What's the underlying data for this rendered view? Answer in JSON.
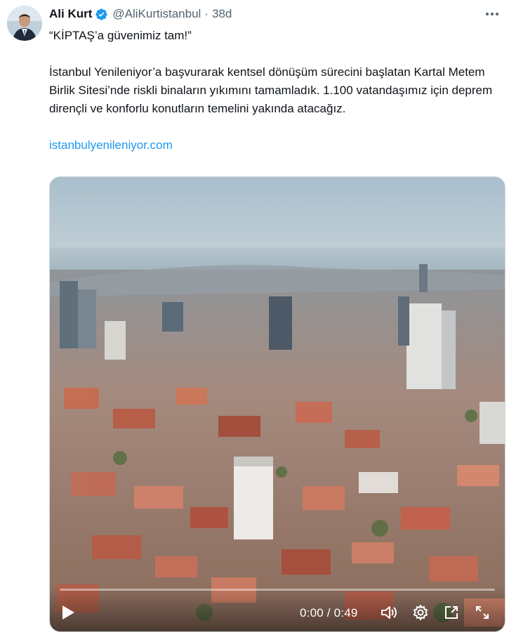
{
  "author": {
    "name": "Ali Kurt",
    "handle": "@AliKurtistanbul",
    "separator": "·",
    "time": "38d",
    "verified_color": "#1d9bf0"
  },
  "tweet": {
    "line1": "“KİPTAŞ’a güvenimiz tam!”",
    "paragraph": "İstanbul Yenileniyor’a başvurarak kentsel dönüşüm sürecini başlatan Kartal Metem Birlik Sitesi’nde riskli binaların yıkımını tamamladık. 1.100 vatandaşımız için deprem dirençli ve konforlu konutların temelini yakında atacağız.",
    "link": "istanbulyenileniyor.com",
    "link_color": "#1d9bf0"
  },
  "video": {
    "time_display": "0:00 / 0:49",
    "progress": 0,
    "icons": [
      "play-icon",
      "volume-icon",
      "settings-gear-icon",
      "picture-in-picture-icon",
      "fullscreen-icon"
    ]
  },
  "icons": {
    "more": "more-dots-icon",
    "verified": "verified-badge-icon"
  }
}
